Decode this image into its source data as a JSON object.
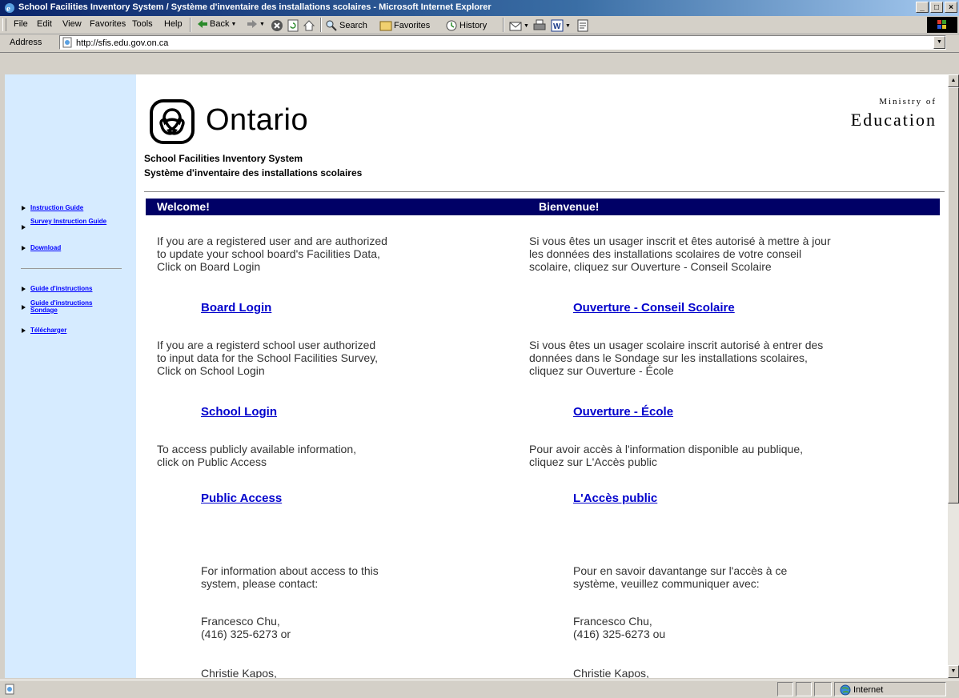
{
  "window": {
    "title": "School Facilities Inventory System / Système d'inventaire des installations scolaires - Microsoft Internet Explorer"
  },
  "menu": [
    "File",
    "Edit",
    "View",
    "Favorites",
    "Tools",
    "Help"
  ],
  "toolbar": {
    "back": "Back",
    "search": "Search",
    "favorites": "Favorites",
    "history": "History"
  },
  "address": {
    "label": "Address",
    "url": "http://sfis.edu.gov.on.ca"
  },
  "sidebar": {
    "english_links": [
      "Instruction Guide",
      "Survey Instruction Guide",
      "Download"
    ],
    "french_links": [
      "Guide d'instructions",
      "Guide d'instructions Sondage",
      "Télécharger"
    ]
  },
  "header": {
    "brand": "Ontario",
    "ministry_line1": "Ministry of",
    "ministry_line2": "Education",
    "subtitle_en": "School Facilities Inventory System",
    "subtitle_fr": "Système d'inventaire des installations scolaires"
  },
  "welcome": {
    "en_heading": "Welcome!",
    "fr_heading": "Bienvenue!",
    "en_board_text": "If you are a registered user and are authorized\nto update your school board's Facilities Data,\nClick on Board Login",
    "fr_board_text": "Si vous êtes un usager inscrit et êtes autorisé à mettre à jour\nles données des installations scolaires de votre conseil\nscolaire, cliquez sur Ouverture - Conseil Scolaire",
    "en_board_link": "Board Login",
    "fr_board_link": "Ouverture - Conseil Scolaire",
    "en_school_text": "If you are a registerd school user authorized\nto input data for the School Facilities Survey,\nClick on School Login",
    "fr_school_text": "Si vous êtes un usager scolaire inscrit autorisé à entrer des\ndonnées dans le Sondage sur les installations scolaires,\ncliquez sur Ouverture - École",
    "en_school_link": "School Login",
    "fr_school_link": "Ouverture - École",
    "en_public_text": "To access publicly available information,\nclick on Public Access",
    "fr_public_text": "Pour avoir accès à l'information disponible au publique,\ncliquez sur L'Accès public",
    "en_public_link": "Public Access",
    "fr_public_link": "L'Accès public",
    "en_contact_text": "For information about access to this\nsystem, please contact:",
    "fr_contact_text": "Pour en savoir davantange sur l'accès à ce\nsystème, veuillez communiquer avec:",
    "contact_name": "Francesco Chu,",
    "en_contact_phone": "(416) 325-6273 or",
    "fr_contact_phone": "(416) 325-6273 ou",
    "contact2_name": "Christie Kapos,"
  },
  "status": {
    "zone": "Internet"
  }
}
